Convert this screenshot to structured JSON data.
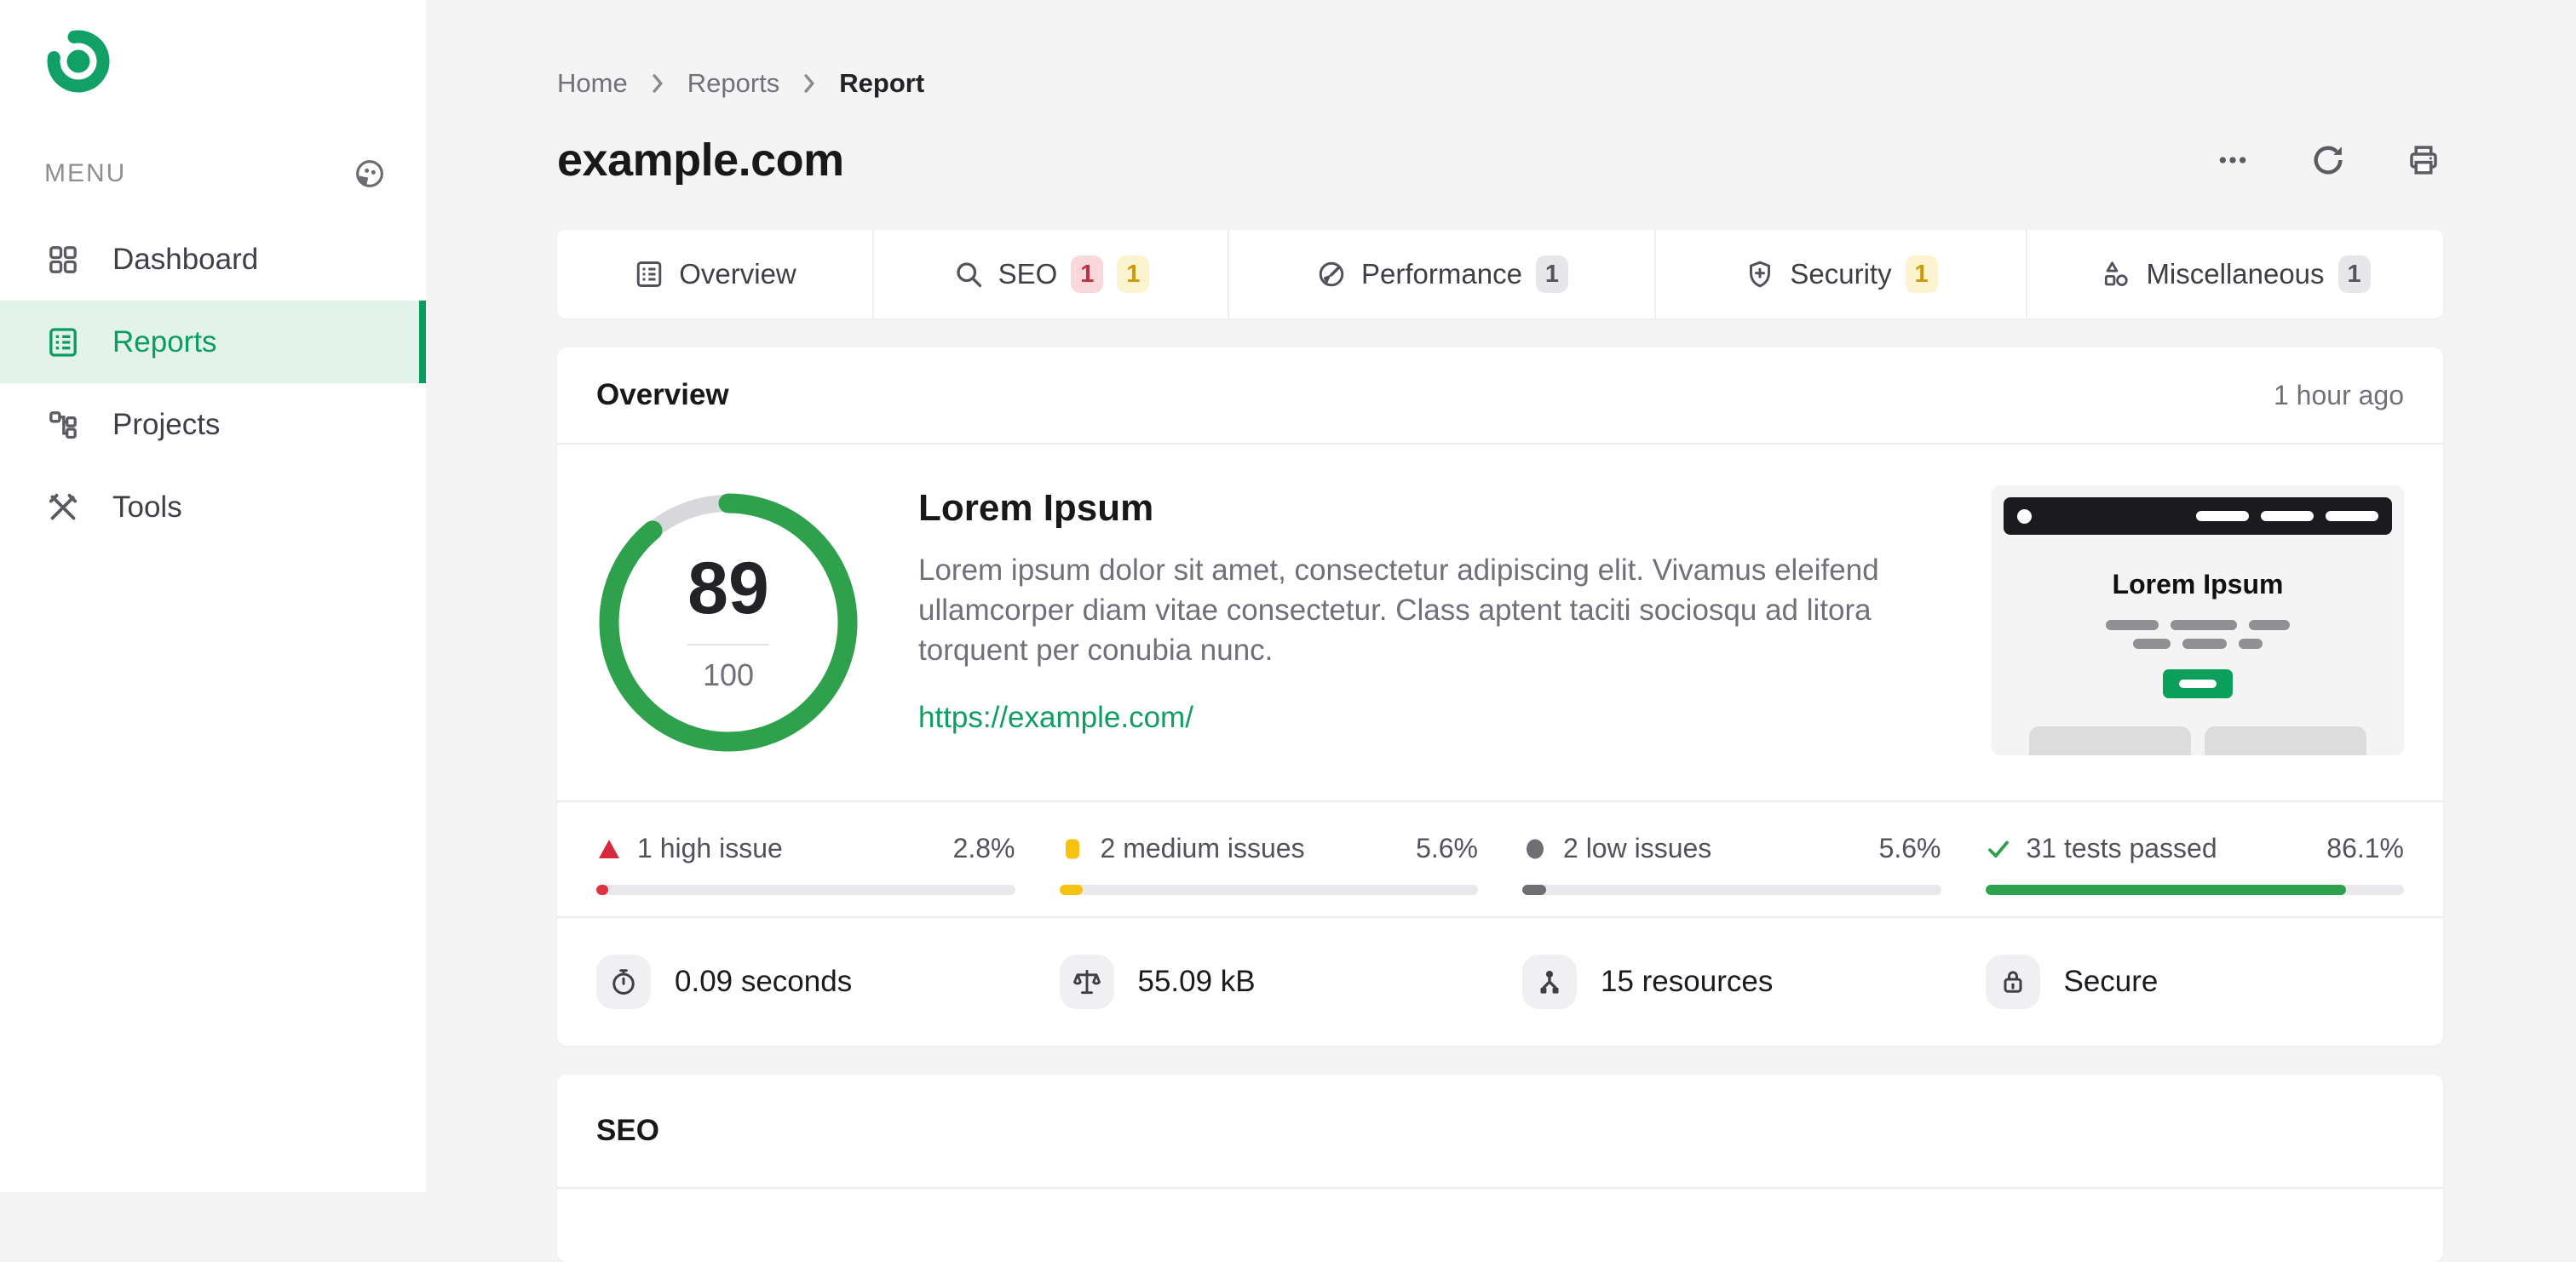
{
  "colors": {
    "brand_green": "#0c9d62",
    "active_nav_bg": "#e3f2ea",
    "success_green": "#2fa14d",
    "high_red": "#e03142",
    "medium_yellow": "#f5c211",
    "low_gray": "#6e6e73",
    "page_bg": "#f4f4f5"
  },
  "sidebar": {
    "menu_label": "MENU",
    "items": [
      {
        "label": "Dashboard",
        "icon": "grid-icon",
        "active": false
      },
      {
        "label": "Reports",
        "icon": "report-icon",
        "active": true
      },
      {
        "label": "Projects",
        "icon": "sitemap-icon",
        "active": false
      },
      {
        "label": "Tools",
        "icon": "tools-icon",
        "active": false
      }
    ]
  },
  "header": {
    "breadcrumb": [
      {
        "label": "Home"
      },
      {
        "label": "Reports"
      },
      {
        "label": "Report"
      }
    ],
    "title": "example.com",
    "actions": [
      {
        "icon": "ellipsis-icon"
      },
      {
        "icon": "refresh-icon"
      },
      {
        "icon": "printer-icon"
      }
    ]
  },
  "tabs": [
    {
      "label": "Overview",
      "icon": "report-icon",
      "badges": []
    },
    {
      "label": "SEO",
      "icon": "search-icon",
      "badges": [
        {
          "text": "1",
          "type": "high"
        },
        {
          "text": "1",
          "type": "medium"
        }
      ]
    },
    {
      "label": "Performance",
      "icon": "gauge-icon",
      "badges": [
        {
          "text": "1",
          "type": "neutral"
        }
      ]
    },
    {
      "label": "Security",
      "icon": "shield-icon",
      "badges": [
        {
          "text": "1",
          "type": "medium"
        }
      ]
    },
    {
      "label": "Miscellaneous",
      "icon": "shapes-icon",
      "badges": [
        {
          "text": "1",
          "type": "neutral"
        }
      ]
    }
  ],
  "overview_card": {
    "title": "Overview",
    "timestamp": "1 hour ago",
    "score": {
      "value": "89",
      "max": "100",
      "percent": 89
    },
    "site": {
      "heading": "Lorem Ipsum",
      "description_lines": [
        "Lorem ipsum dolor sit amet, consectetur adipiscing elit. Vivamus eleifend",
        "ullamcorper diam vitae consectetur. Class aptent taciti sociosqu ad litora",
        "torquent per conubia nunc."
      ],
      "url": "https://example.com/"
    },
    "preview": {
      "heading": "Lorem Ipsum"
    },
    "stats": [
      {
        "label": "1 high issue",
        "percent_label": "2.8%",
        "percent": 2.8,
        "severity": "high",
        "icon": "triangle-icon"
      },
      {
        "label": "2 medium issues",
        "percent_label": "5.6%",
        "percent": 5.6,
        "severity": "medium",
        "icon": "square-icon"
      },
      {
        "label": "2 low issues",
        "percent_label": "5.6%",
        "percent": 5.6,
        "severity": "low",
        "icon": "circle-icon"
      },
      {
        "label": "31 tests passed",
        "percent_label": "86.1%",
        "percent": 86.1,
        "severity": "passed",
        "icon": "check-icon"
      }
    ],
    "metrics": [
      {
        "label": "0.09 seconds",
        "icon": "stopwatch-icon"
      },
      {
        "label": "55.09 kB",
        "icon": "scale-icon"
      },
      {
        "label": "15 resources",
        "icon": "resources-icon"
      },
      {
        "label": "Secure",
        "icon": "lock-icon"
      }
    ]
  },
  "seo_card": {
    "title": "SEO"
  }
}
